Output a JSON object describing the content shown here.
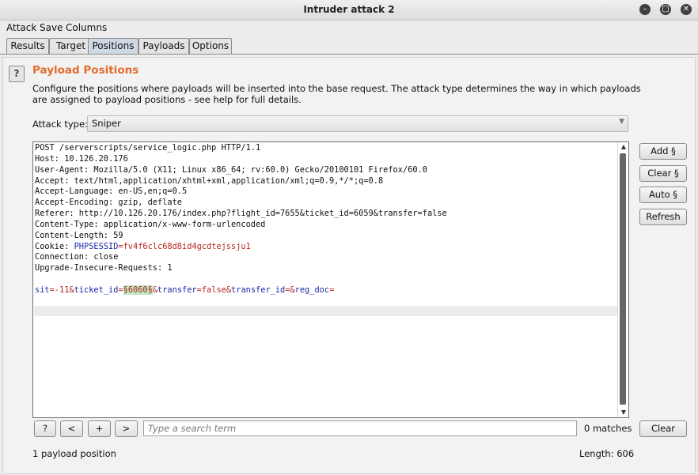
{
  "window": {
    "title": "Intruder attack 2"
  },
  "menu": {
    "items": [
      "Attack",
      "Save",
      "Columns"
    ]
  },
  "tabs": [
    "Results",
    "Target",
    "Positions",
    "Payloads",
    "Options"
  ],
  "active_tab": "Positions",
  "panel": {
    "help_label": "?",
    "title": "Payload Positions",
    "description": "Configure the positions where payloads will be inserted into the base request. The attack type determines the way in which payloads are assigned to payload positions - see help for full details.",
    "attack_type_label": "Attack type:",
    "attack_type_value": "Sniper"
  },
  "request": {
    "lines": [
      "POST /serverscripts/service_logic.php HTTP/1.1",
      "Host: 10.126.20.176",
      "User-Agent: Mozilla/5.0 (X11; Linux x86_64; rv:60.0) Gecko/20100101 Firefox/60.0",
      "Accept: text/html,application/xhtml+xml,application/xml;q=0.9,*/*;q=0.8",
      "Accept-Language: en-US,en;q=0.5",
      "Accept-Encoding: gzip, deflate",
      "Referer: http://10.126.20.176/index.php?flight_id=7655&ticket_id=6059&transfer=false",
      "Content-Type: application/x-www-form-urlencoded",
      "Content-Length: 59"
    ],
    "cookie_prefix": "Cookie: ",
    "cookie_name": "PHPSESSID",
    "cookie_eq": "=",
    "cookie_value": "fv4f6clc68d8id4gcdtejssju1",
    "lines_after": [
      "Connection: close",
      "Upgrade-Insecure-Requests: 1"
    ],
    "body": [
      {
        "key": "sit",
        "eq": "=",
        "val": "-11",
        "amp": "&"
      },
      {
        "key": "ticket_id",
        "eq": "=",
        "marker": "§6060§",
        "amp": "&"
      },
      {
        "key": "transfer",
        "eq": "=",
        "val": "false",
        "amp": "&"
      },
      {
        "key": "transfer_id",
        "eq": "=",
        "val": "",
        "amp": "&"
      },
      {
        "key": "reg_doc",
        "eq": "=",
        "val": "",
        "amp": ""
      }
    ]
  },
  "side_buttons": [
    "Add §",
    "Clear §",
    "Auto §",
    "Refresh"
  ],
  "search": {
    "help": "?",
    "prev": "<",
    "add": "+",
    "next": ">",
    "placeholder": "Type a search term",
    "matches": "0 matches",
    "clear": "Clear"
  },
  "status": {
    "positions": "1 payload position",
    "length": "Length: 606"
  },
  "colors": {
    "heading": "#e36b2c",
    "param_key": "#1b2aa8",
    "param_value": "#b3261e",
    "marker_bg": "#bfe8c2",
    "active_tab": "#cfd9e6"
  }
}
